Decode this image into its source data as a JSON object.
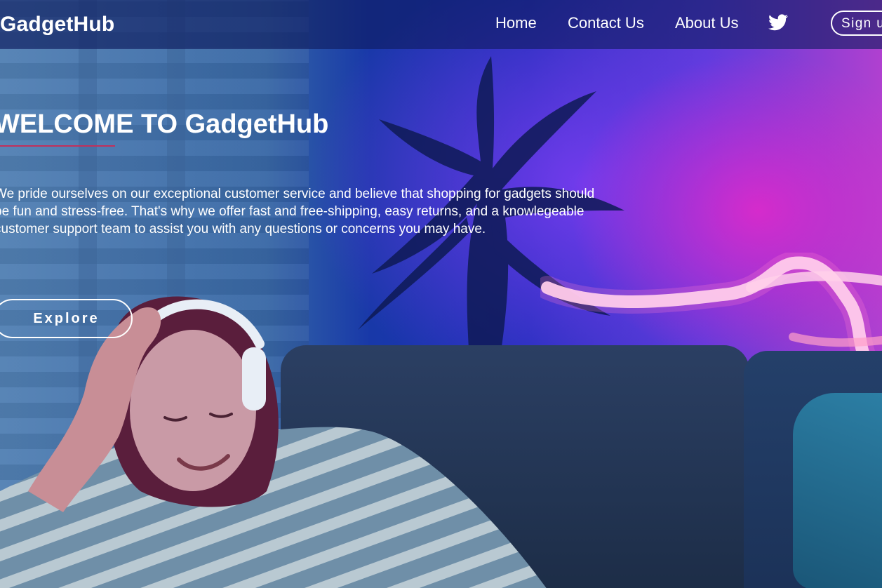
{
  "header": {
    "logo": "GadgetHub",
    "nav": [
      "Home",
      "Contact Us",
      "About Us"
    ],
    "social_icon": "twitter-icon",
    "signup_label": "Sign up"
  },
  "hero": {
    "title": "WELCOME TO GadgetHub",
    "description": "We pride ourselves on our exceptional customer service and believe that shopping for gadgets should be fun and stress-free. That's why we offer fast and free-shipping, easy returns, and a knowlegeable customer support team to assist you with any questions or concerns you may have.",
    "button_label": "Explore"
  },
  "colors": {
    "header_bg": "#0f1c60",
    "underline": "#c1305c",
    "text": "#ffffff"
  }
}
